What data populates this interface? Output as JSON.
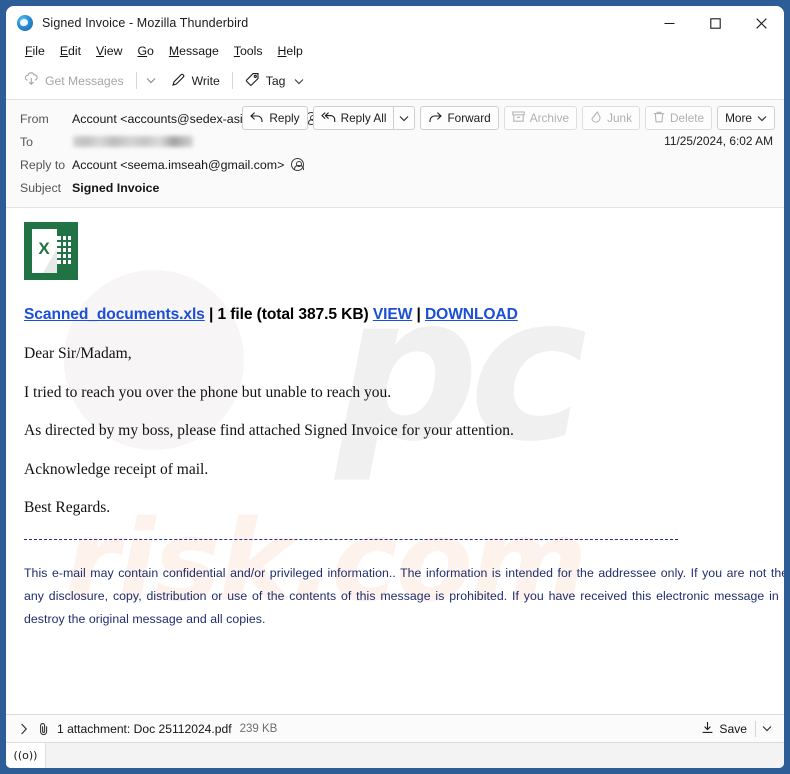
{
  "window": {
    "title": "Signed Invoice - Mozilla Thunderbird",
    "app_icon": "thunderbird-icon",
    "controls": {
      "minimize": "minimize-icon",
      "maximize": "maximize-icon",
      "close": "close-icon"
    }
  },
  "menubar": {
    "items": [
      {
        "label": "File",
        "accesskey": "F"
      },
      {
        "label": "Edit",
        "accesskey": "E"
      },
      {
        "label": "View",
        "accesskey": "V"
      },
      {
        "label": "Go",
        "accesskey": "G"
      },
      {
        "label": "Message",
        "accesskey": "M"
      },
      {
        "label": "Tools",
        "accesskey": "T"
      },
      {
        "label": "Help",
        "accesskey": "H"
      }
    ]
  },
  "toolbar": {
    "get_messages": "Get Messages",
    "write": "Write",
    "tag": "Tag"
  },
  "message_header": {
    "from_label": "From",
    "from_value": "Account <accounts@sedex-asia-th.com>",
    "to_label": "To",
    "to_value": "",
    "reply_to_label": "Reply to",
    "reply_to_value": "Account <seema.imseah@gmail.com>",
    "subject_label": "Subject",
    "subject_value": "Signed Invoice",
    "date": "11/25/2024, 6:02 AM",
    "actions": {
      "reply": "Reply",
      "reply_all": "Reply All",
      "forward": "Forward",
      "archive": "Archive",
      "junk": "Junk",
      "delete": "Delete",
      "more": "More"
    }
  },
  "body": {
    "file_icon": "excel-file-icon",
    "attachment_link": "Scanned_documents.xls",
    "attachment_meta": " | 1 file (total 387.5 KB) ",
    "view_link": "VIEW",
    "link_separator": " | ",
    "download_link": "DOWNLOAD",
    "paragraphs": [
      "Dear Sir/Madam,",
      "I tried to reach you over the phone but unable to reach you.",
      "As directed by my boss, please find attached Signed Invoice for your attention.",
      "Acknowledge receipt of mail.",
      "Best Regards."
    ],
    "divider": "------------------------------------------------------------------------------------------------------",
    "disclaimer": "This e-mail may contain confidential and/or privileged information.. The information is intended for the addressee only. If you are not the addressee, any disclosure, copy, distribution or use of the contents of this message is prohibited. If you have received this electronic message in error, please destroy the original message and all copies.",
    "watermark_primary": "pc",
    "watermark_secondary": "risk.com"
  },
  "attachment_bar": {
    "expand": "chevron-right-icon",
    "clip": "paperclip-icon",
    "text": "1 attachment: Doc 25112024.pdf",
    "size": "239 KB",
    "save_label": "Save"
  },
  "statusbar": {
    "indicator": "((o))"
  },
  "colors": {
    "desktop": "#2c5d96",
    "link": "#1a4fd6",
    "disclaimer": "#1f2d6e",
    "excel_green": "#217346"
  }
}
